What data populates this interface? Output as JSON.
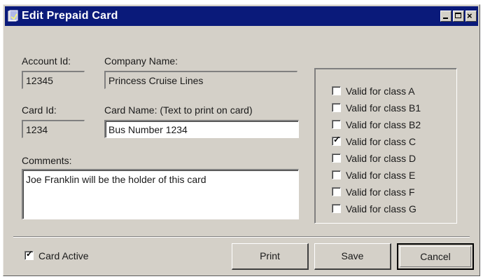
{
  "window": {
    "title": "Edit Prepaid Card",
    "title_bar_color": "#0a1a7a",
    "face_color": "#d4d0c8"
  },
  "fields": {
    "account_id": {
      "label": "Account Id:",
      "value": "12345"
    },
    "company_name": {
      "label": "Company Name:",
      "value": "Princess Cruise Lines"
    },
    "card_id": {
      "label": "Card Id:",
      "value": "1234"
    },
    "card_name": {
      "label": "Card Name: (Text to print on card)",
      "value": "Bus Number 1234"
    },
    "comments": {
      "label": "Comments:",
      "value": "Joe Franklin will be the holder of this card"
    }
  },
  "classes": [
    {
      "label": "Valid for class A",
      "checked": false
    },
    {
      "label": "Valid for class B1",
      "checked": false
    },
    {
      "label": "Valid for class B2",
      "checked": false
    },
    {
      "label": "Valid for class C",
      "checked": true
    },
    {
      "label": "Valid for class D",
      "checked": false
    },
    {
      "label": "Valid for class E",
      "checked": false
    },
    {
      "label": "Valid for class F",
      "checked": false
    },
    {
      "label": "Valid for class G",
      "checked": false
    }
  ],
  "card_active": {
    "label": "Card Active",
    "checked": true
  },
  "buttons": {
    "print": "Print",
    "save": "Save",
    "cancel": "Cancel"
  },
  "icons": {
    "check_mark": "✓",
    "close_glyph": "×"
  }
}
